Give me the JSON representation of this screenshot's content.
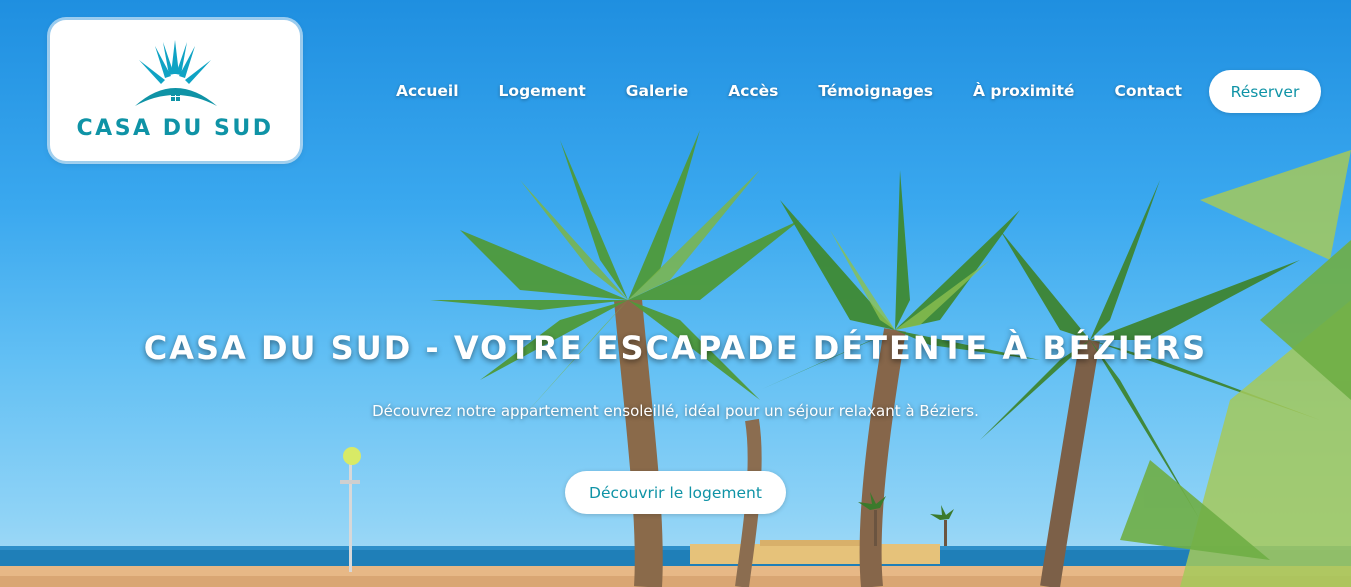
{
  "brand": {
    "logo_text": "CASA DU SUD",
    "logo_icon": "sun-house-emblem-icon",
    "primary_color": "#0f93a6",
    "sky_color": "#3aa8ef"
  },
  "nav": {
    "items": [
      {
        "label": "Accueil"
      },
      {
        "label": "Logement"
      },
      {
        "label": "Galerie"
      },
      {
        "label": "Accès"
      },
      {
        "label": "Témoignages"
      },
      {
        "label": "À proximité"
      },
      {
        "label": "Contact"
      }
    ],
    "cta_label": "Réserver"
  },
  "hero": {
    "title": "CASA DU SUD - VOTRE ESCAPADE DÉTENTE À BÉZIERS",
    "subtitle": "Découvrez notre appartement ensoleillé, idéal pour un séjour relaxant à Béziers.",
    "cta_label": "Découvrir le logement",
    "background": "beach-palm-trees-photo"
  }
}
